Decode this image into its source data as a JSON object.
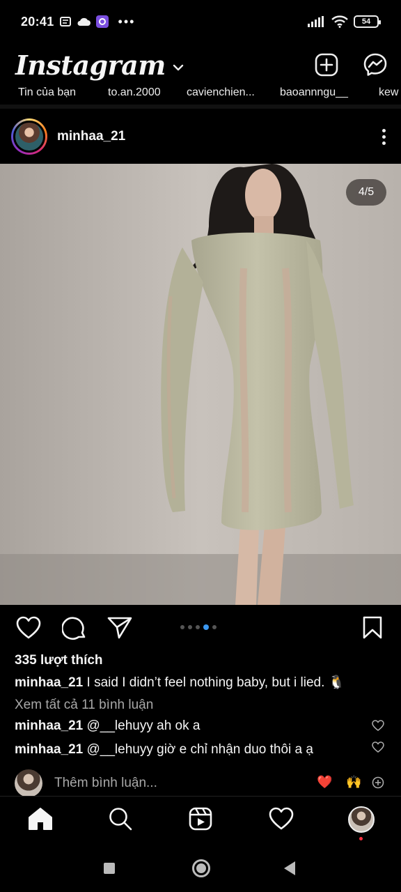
{
  "status_bar": {
    "time": "20:41",
    "battery": "54"
  },
  "header": {
    "logo": "Instagram"
  },
  "stories": [
    "Tin của bạn",
    "to.an.2000",
    "cavienchien...",
    "baoannngu__",
    "kew"
  ],
  "post": {
    "username": "minhaa_21",
    "counter": "4/5",
    "carousel": {
      "total": 5,
      "active_index": 3
    },
    "likes": "335 lượt thích",
    "caption_user": "minhaa_21",
    "caption_text": "I said I didn’t feel nothing baby, but i lied. 🐧",
    "view_all": "Xem tất cả 11 bình luận",
    "comments": [
      {
        "user": "minhaa_21",
        "text": "@__lehuyy ah ok a"
      },
      {
        "user": "minhaa_21",
        "text": "@__lehuyy giờ e chỉ nhận duo thôi a ạ"
      }
    ],
    "add_comment_placeholder": "Thêm bình luận...",
    "quick_emojis": [
      "❤️",
      "🙌"
    ]
  },
  "colors": {
    "background": "#000000",
    "accent_blue": "#3b97f0",
    "notification_red": "#ff3040",
    "secondary_text": "#a8a8a8"
  },
  "icons": {
    "header": [
      "new-post-icon",
      "messenger-icon"
    ],
    "actions": [
      "heart-icon",
      "comment-icon",
      "share-icon",
      "bookmark-icon"
    ],
    "nav": [
      "home-icon",
      "search-icon",
      "reels-icon",
      "activity-heart-icon",
      "profile-avatar"
    ]
  }
}
